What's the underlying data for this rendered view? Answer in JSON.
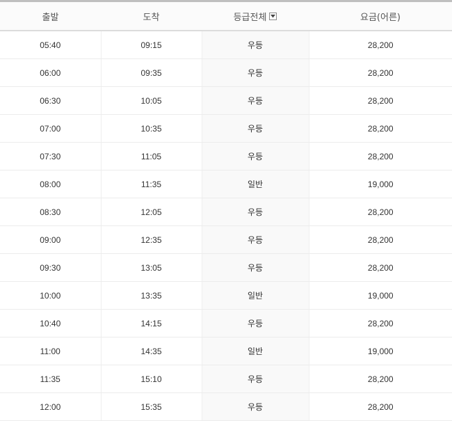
{
  "header": {
    "departure": "출발",
    "arrival": "도착",
    "grade": "등급전체",
    "fare": "요금(어른)"
  },
  "rows": [
    {
      "departure": "05:40",
      "arrival": "09:15",
      "grade": "우등",
      "fare": "28,200"
    },
    {
      "departure": "06:00",
      "arrival": "09:35",
      "grade": "우등",
      "fare": "28,200"
    },
    {
      "departure": "06:30",
      "arrival": "10:05",
      "grade": "우등",
      "fare": "28,200"
    },
    {
      "departure": "07:00",
      "arrival": "10:35",
      "grade": "우등",
      "fare": "28,200"
    },
    {
      "departure": "07:30",
      "arrival": "11:05",
      "grade": "우등",
      "fare": "28,200"
    },
    {
      "departure": "08:00",
      "arrival": "11:35",
      "grade": "일반",
      "fare": "19,000"
    },
    {
      "departure": "08:30",
      "arrival": "12:05",
      "grade": "우등",
      "fare": "28,200"
    },
    {
      "departure": "09:00",
      "arrival": "12:35",
      "grade": "우등",
      "fare": "28,200"
    },
    {
      "departure": "09:30",
      "arrival": "13:05",
      "grade": "우등",
      "fare": "28,200"
    },
    {
      "departure": "10:00",
      "arrival": "13:35",
      "grade": "일반",
      "fare": "19,000"
    },
    {
      "departure": "10:40",
      "arrival": "14:15",
      "grade": "우등",
      "fare": "28,200"
    },
    {
      "departure": "11:00",
      "arrival": "14:35",
      "grade": "일반",
      "fare": "19,000"
    },
    {
      "departure": "11:35",
      "arrival": "15:10",
      "grade": "우등",
      "fare": "28,200"
    },
    {
      "departure": "12:00",
      "arrival": "15:35",
      "grade": "우등",
      "fare": "28,200"
    }
  ],
  "icons": {
    "grade_filter": "chevron-down-icon"
  }
}
